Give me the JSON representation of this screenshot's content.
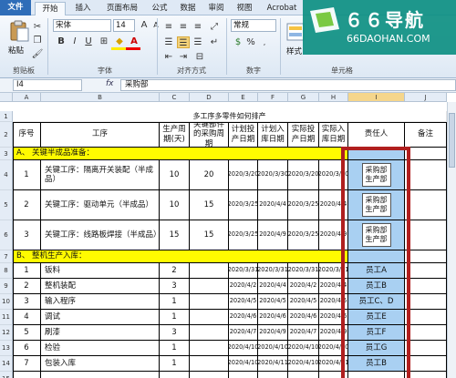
{
  "ribbon_tabs": [
    "文件",
    "开始",
    "插入",
    "页面布局",
    "公式",
    "数据",
    "审阅",
    "视图",
    "Acrobat"
  ],
  "ribbon": {
    "paste": "粘贴",
    "font_name": "宋体",
    "font_size": "14",
    "number_format": "常规",
    "style": "样式",
    "groups": [
      "剪贴板",
      "字体",
      "对齐方式",
      "数字",
      "单元格"
    ],
    "bold": "B",
    "italic": "I",
    "underline": "U"
  },
  "formula_bar": {
    "name_box": "I4",
    "fx": "fx",
    "content": "采购部"
  },
  "watermark": {
    "text": "６６导航",
    "url": "66DAOHAN.COM"
  },
  "columns": [
    "A",
    "B",
    "C",
    "D",
    "E",
    "F",
    "G",
    "H",
    "I",
    "J"
  ],
  "rows": [
    "1",
    "2",
    "3",
    "4",
    "5",
    "6",
    "7",
    "8",
    "9",
    "10",
    "11",
    "12",
    "13",
    "14",
    "15",
    "16",
    "17",
    "18"
  ],
  "sheet": {
    "title": "多工序多零件如何排产",
    "headers": [
      "序号",
      "工序",
      "生产周期(天)",
      "关键部件的采购周期",
      "计划投产日期",
      "计划入库日期",
      "实际投产日期",
      "实际入库日期",
      "责任人",
      "备注"
    ],
    "section_a": "A、  关键半成品准备：",
    "section_b": "B、  整机生产入库：",
    "a_rows": [
      {
        "no": "1",
        "step": "关键工序：隔离开关装配（半成品）",
        "cycle": "10",
        "purchase": "20",
        "plan_start": "2020/3/20",
        "plan_in": "2020/3/30",
        "act_start": "2020/3/20",
        "act_in": "2020/3/30",
        "owner": "采购部\n生产部"
      },
      {
        "no": "2",
        "step": "关键工序：驱动单元（半成品）",
        "cycle": "10",
        "purchase": "15",
        "plan_start": "2020/3/25",
        "plan_in": "2020/4/4",
        "act_start": "2020/3/25",
        "act_in": "2020/4/4",
        "owner": "采购部\n生产部"
      },
      {
        "no": "3",
        "step": "关键工序：线路板焊接（半成品）",
        "cycle": "15",
        "purchase": "15",
        "plan_start": "2020/3/25",
        "plan_in": "2020/4/9",
        "act_start": "2020/3/25",
        "act_in": "2020/4/9",
        "owner": "采购部\n生产部"
      }
    ],
    "b_rows": [
      {
        "no": "1",
        "step": "钣料",
        "cycle": "2",
        "plan_start": "2020/3/31",
        "plan_in": "2020/3/31",
        "act_start": "2020/3/31",
        "act_in": "2020/3/31",
        "owner": "员工A"
      },
      {
        "no": "2",
        "step": "整机装配",
        "cycle": "3",
        "plan_start": "2020/4/2",
        "plan_in": "2020/4/4",
        "act_start": "2020/4/2",
        "act_in": "2020/4/4",
        "owner": "员工B"
      },
      {
        "no": "3",
        "step": "输入程序",
        "cycle": "1",
        "plan_start": "2020/4/5",
        "plan_in": "2020/4/5",
        "act_start": "2020/4/5",
        "act_in": "2020/4/5",
        "owner": "员工C、D"
      },
      {
        "no": "4",
        "step": "调试",
        "cycle": "1",
        "plan_start": "2020/4/6",
        "plan_in": "2020/4/6",
        "act_start": "2020/4/6",
        "act_in": "2020/4/6",
        "owner": "员工E"
      },
      {
        "no": "5",
        "step": "刷漆",
        "cycle": "3",
        "plan_start": "2020/4/7",
        "plan_in": "2020/4/9",
        "act_start": "2020/4/7",
        "act_in": "2020/4/9",
        "owner": "员工F"
      },
      {
        "no": "6",
        "step": "检验",
        "cycle": "1",
        "plan_start": "2020/4/10",
        "plan_in": "2020/4/10",
        "act_start": "2020/4/10",
        "act_in": "2020/4/10",
        "owner": "员工G"
      },
      {
        "no": "7",
        "step": "包装入库",
        "cycle": "1",
        "plan_start": "2020/4/10",
        "plan_in": "2020/4/11",
        "act_start": "2020/4/10",
        "act_in": "2020/4/11",
        "owner": "员工B"
      }
    ]
  },
  "colors": {
    "section": "#fffb00",
    "owner_fill": "#a9d0f2",
    "highlight_border": "#b01f1f",
    "file_tab": "#2f6db8"
  }
}
